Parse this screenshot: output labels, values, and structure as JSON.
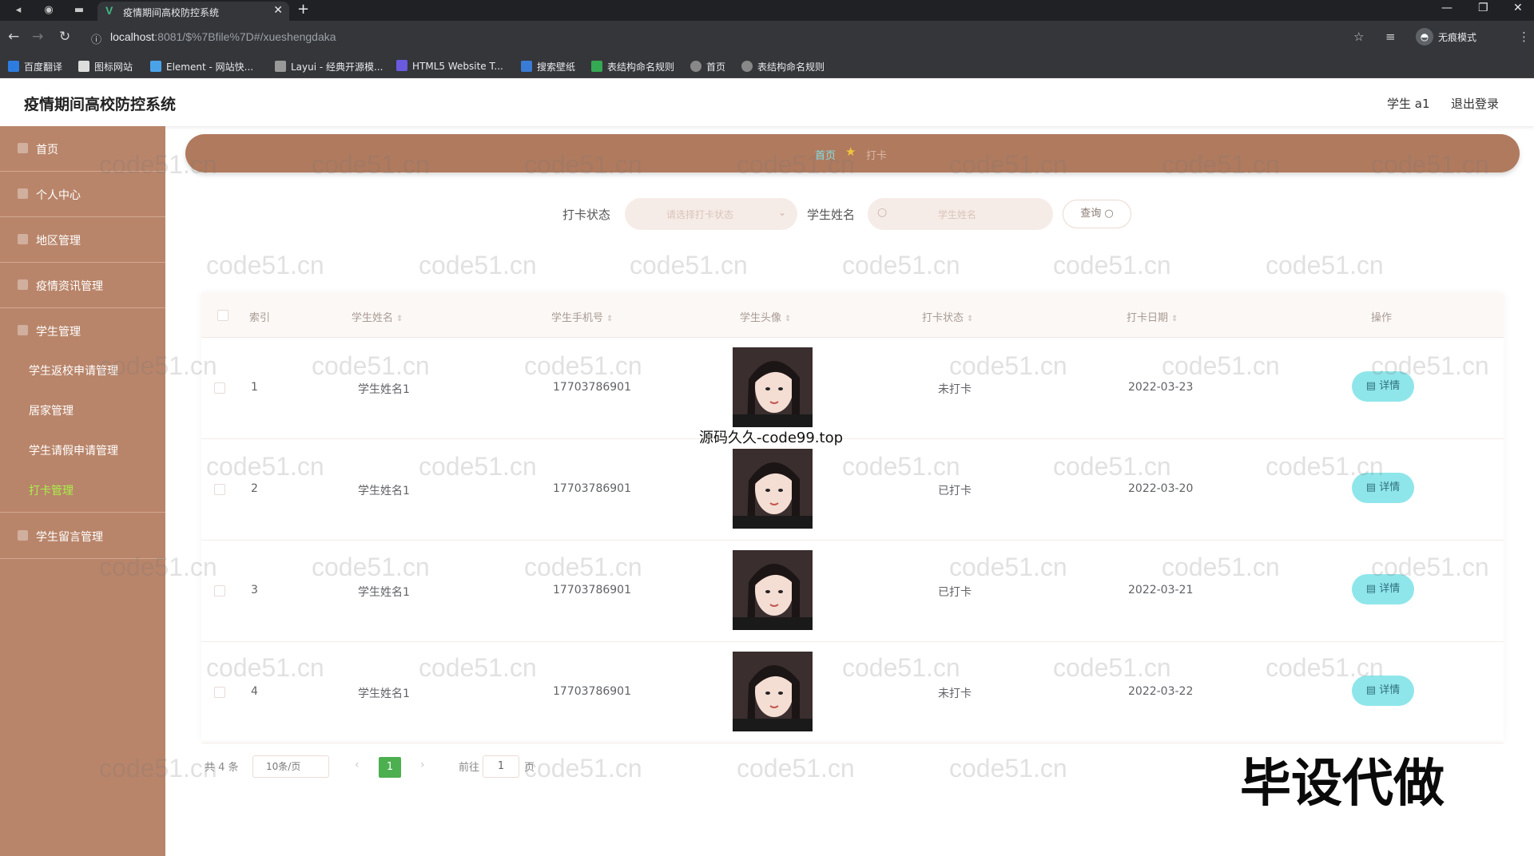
{
  "browser": {
    "tab_title": "疫情期间高校防控系统",
    "url_host": "localhost",
    "url_rest": ":8081/$%7Bfile%7D#/xueshengdaka",
    "incognito_label": "无痕模式",
    "bookmarks": [
      "百度翻译",
      "图标网站",
      "Element - 网站快...",
      "Layui - 经典开源模...",
      "HTML5 Website T...",
      "搜索壁纸",
      "表结构命名规则",
      "首页",
      "表结构命名规则"
    ]
  },
  "header": {
    "title": "疫情期间高校防控系统",
    "user": "学生 a1",
    "logout": "退出登录"
  },
  "sidebar": {
    "items": [
      {
        "label": "首页"
      },
      {
        "label": "个人中心"
      },
      {
        "label": "地区管理"
      },
      {
        "label": "疫情资讯管理"
      },
      {
        "label": "学生管理"
      },
      {
        "label": "学生留言管理"
      }
    ],
    "sub_items": [
      {
        "label": "学生返校申请管理"
      },
      {
        "label": "居家管理"
      },
      {
        "label": "学生请假申请管理"
      },
      {
        "label": "打卡管理"
      }
    ]
  },
  "breadcrumb": {
    "home": "首页",
    "current": "打卡"
  },
  "search": {
    "status_label": "打卡状态",
    "status_placeholder": "请选择打卡状态",
    "name_label": "学生姓名",
    "name_placeholder": "学生姓名",
    "query_button": "查询"
  },
  "table": {
    "columns": [
      "索引",
      "学生姓名",
      "学生手机号",
      "学生头像",
      "打卡状态",
      "打卡日期",
      "操作"
    ],
    "rows": [
      {
        "index": "1",
        "name": "学生姓名1",
        "phone": "17703786901",
        "status": "未打卡",
        "date": "2022-03-23",
        "action": "详情"
      },
      {
        "index": "2",
        "name": "学生姓名1",
        "phone": "17703786901",
        "status": "已打卡",
        "date": "2022-03-20",
        "action": "详情"
      },
      {
        "index": "3",
        "name": "学生姓名1",
        "phone": "17703786901",
        "status": "已打卡",
        "date": "2022-03-21",
        "action": "详情"
      },
      {
        "index": "4",
        "name": "学生姓名1",
        "phone": "17703786901",
        "status": "未打卡",
        "date": "2022-03-22",
        "action": "详情"
      }
    ]
  },
  "pagination": {
    "total": "共 4 条",
    "page_size": "10条/页",
    "current": "1",
    "goto_label": "前往",
    "goto_value": "1",
    "page_suffix": "页"
  },
  "overlay": {
    "caption": "源码久久-code99.top",
    "stamp": "毕设代做",
    "watermark": "code51.cn"
  },
  "colors": {
    "sidebar": "#b9856a",
    "breadcrumb": "#b07a5e",
    "active_menu": "#a8f04a",
    "detail_button": "#8fe6ea",
    "current_page": "#4caf50"
  }
}
